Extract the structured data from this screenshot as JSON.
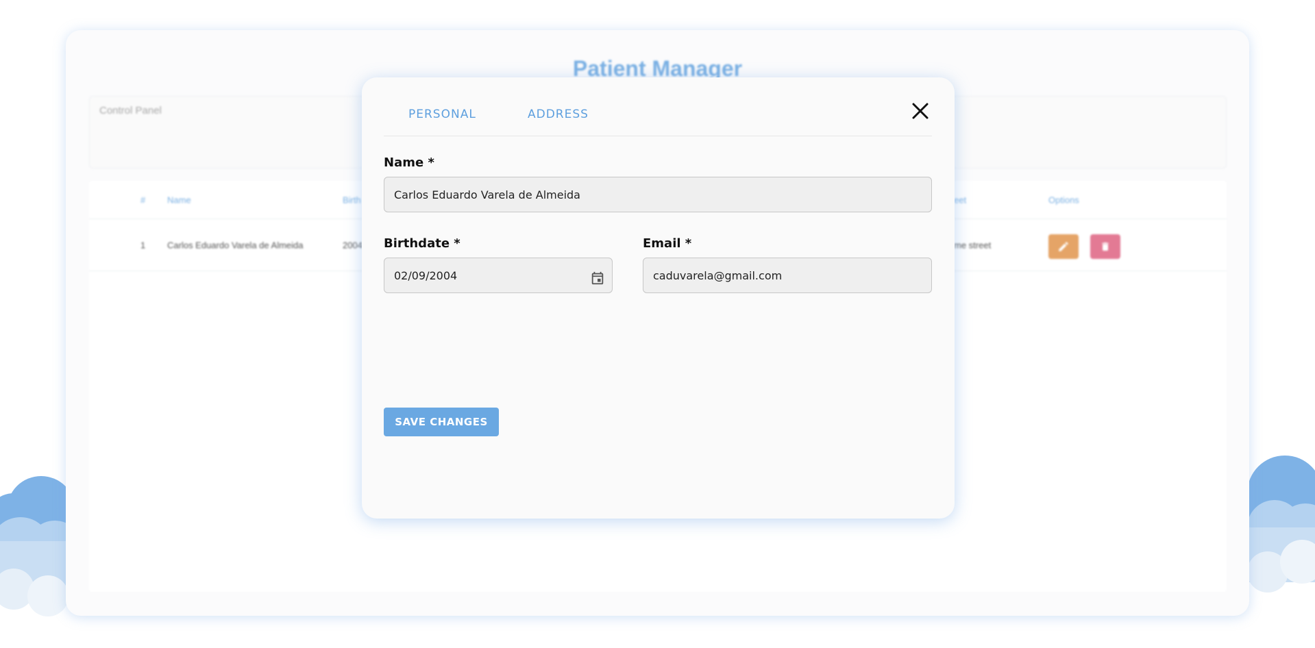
{
  "app": {
    "title": "Patient Manager",
    "control_panel_label": "Control Panel"
  },
  "table": {
    "headers": [
      "#",
      "Name",
      "Birth",
      "eet",
      "Options"
    ],
    "rows": [
      {
        "index": "1",
        "name": "Carlos Eduardo Varela de Almeida",
        "birth": "2004",
        "street": "me street"
      }
    ]
  },
  "modal": {
    "tabs": {
      "personal": "PERSONAL",
      "address": "ADDRESS"
    },
    "name": {
      "label": "Name *",
      "value": "Carlos Eduardo Varela de Almeida"
    },
    "birthdate": {
      "label": "Birthdate *",
      "value": "02/09/2004"
    },
    "email": {
      "label": "Email *",
      "value": "caduvarela@gmail.com"
    },
    "save_label": "SAVE CHANGES"
  },
  "icons": {
    "close": "close-icon",
    "calendar": "calendar-icon",
    "edit": "pencil-icon",
    "delete": "trash-icon"
  },
  "colors": {
    "accent": "#6aa8e2",
    "title": "#7ab0e3",
    "edit_button": "#e5a467",
    "delete_button": "#e37a94",
    "cloud_dark": "#7eb2e6",
    "cloud_light": "#c9def3"
  }
}
